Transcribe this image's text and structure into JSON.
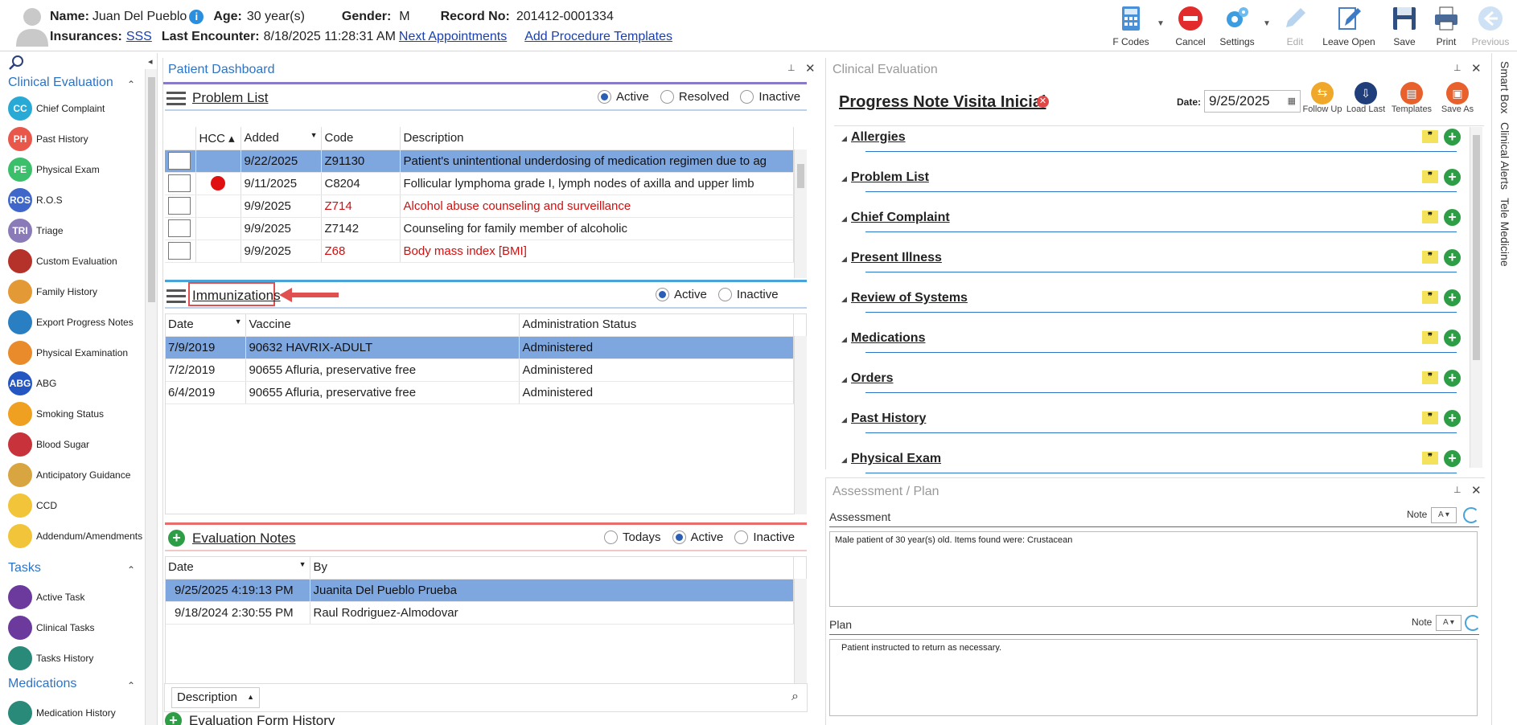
{
  "header": {
    "name_label": "Name:",
    "name": "Juan Del Pueblo",
    "age_label": "Age:",
    "age": "30 year(s)",
    "gender_label": "Gender:",
    "gender": "M",
    "record_label": "Record No:",
    "record": "201412-0001334",
    "insurances_label": "Insurances:",
    "insurance": "SSS",
    "last_encounter_label": "Last Encounter:",
    "last_encounter": "8/18/2025 11:28:31 AM",
    "next_appointments": "Next Appointments",
    "add_procedure_templates": "Add Procedure Templates"
  },
  "toolbar": {
    "fcodes": "F Codes",
    "cancel": "Cancel",
    "settings": "Settings",
    "edit": "Edit",
    "leave_open": "Leave Open",
    "save": "Save",
    "print": "Print",
    "previous": "Previous"
  },
  "sidebar": {
    "clinical_evaluation": "Clinical Evaluation",
    "items": [
      {
        "abbr": "CC",
        "label": "Chief Complaint",
        "color": "#29a9d6"
      },
      {
        "abbr": "PH",
        "label": "Past History",
        "color": "#e8574a"
      },
      {
        "abbr": "PE",
        "label": "Physical Exam",
        "color": "#3cbf6b"
      },
      {
        "abbr": "ROS",
        "label": "R.O.S",
        "color": "#3f66c9"
      },
      {
        "abbr": "TRI",
        "label": "Triage",
        "color": "#8a7bb8"
      },
      {
        "abbr": "",
        "label": "Custom Evaluation",
        "color": "#b5322a"
      },
      {
        "abbr": "",
        "label": "Family History",
        "color": "#e39a36"
      },
      {
        "abbr": "",
        "label": "Export Progress Notes",
        "color": "#2a7fc3"
      },
      {
        "abbr": "",
        "label": "Physical Examination",
        "color": "#e98b2b"
      },
      {
        "abbr": "ABG",
        "label": "ABG",
        "color": "#2456c2"
      },
      {
        "abbr": "",
        "label": "Smoking Status",
        "color": "#f0a020"
      },
      {
        "abbr": "",
        "label": "Blood Sugar",
        "color": "#c8323a"
      },
      {
        "abbr": "",
        "label": "Anticipatory Guidance",
        "color": "#d8a540"
      },
      {
        "abbr": "",
        "label": "CCD",
        "color": "#f2c43a"
      },
      {
        "abbr": "",
        "label": "Addendum/Amendments",
        "color": "#f2c43a"
      }
    ],
    "tasks": "Tasks",
    "task_items": [
      {
        "label": "Active Task",
        "color": "#6b3a9c"
      },
      {
        "label": "Clinical Tasks",
        "color": "#6b3a9c"
      },
      {
        "label": "Tasks History",
        "color": "#2a8a7a"
      }
    ],
    "medications": "Medications",
    "med_items": [
      {
        "label": "Medication History",
        "color": "#2a8a7a"
      }
    ]
  },
  "dashboard": {
    "title": "Patient Dashboard",
    "problem_list": {
      "title": "Problem List",
      "filters": [
        "Active",
        "Resolved",
        "Inactive"
      ],
      "columns": [
        "HCC",
        "Added",
        "Code",
        "Description"
      ],
      "rows": [
        {
          "hcc": "",
          "added": "9/22/2025",
          "code": "Z91130",
          "desc": "Patient's unintentional underdosing of medication regimen due to ag",
          "red": false,
          "selected": true
        },
        {
          "hcc": "dot",
          "added": "9/11/2025",
          "code": "C8204",
          "desc": "Follicular lymphoma grade I, lymph nodes of axilla and upper limb",
          "red": false,
          "selected": false
        },
        {
          "hcc": "",
          "added": "9/9/2025",
          "code": "Z714",
          "desc": "Alcohol abuse counseling and surveillance",
          "red": true,
          "selected": false
        },
        {
          "hcc": "",
          "added": "9/9/2025",
          "code": "Z7142",
          "desc": "Counseling for family member of alcoholic",
          "red": false,
          "selected": false
        },
        {
          "hcc": "",
          "added": "9/9/2025",
          "code": "Z68",
          "desc": "Body mass index [BMI]",
          "red": true,
          "selected": false
        }
      ]
    },
    "immunizations": {
      "title": "Immunizations",
      "filters": [
        "Active",
        "Inactive"
      ],
      "columns": [
        "Date",
        "Vaccine",
        "Administration Status"
      ],
      "rows": [
        {
          "date": "7/9/2019",
          "vaccine": "90632 HAVRIX-ADULT",
          "status": "Administered",
          "selected": true
        },
        {
          "date": "7/2/2019",
          "vaccine": "90655 Afluria, preservative free",
          "status": "Administered",
          "selected": false
        },
        {
          "date": "6/4/2019",
          "vaccine": "90655 Afluria, preservative free",
          "status": "Administered",
          "selected": false
        }
      ]
    },
    "evaluation_notes": {
      "title": "Evaluation Notes",
      "filters": [
        "Todays",
        "Active",
        "Inactive"
      ],
      "columns": [
        "Date",
        "By"
      ],
      "rows": [
        {
          "date": "9/25/2025 4:19:13 PM",
          "by": "Juanita Del Pueblo Prueba",
          "selected": true
        },
        {
          "date": "9/18/2024 2:30:55 PM",
          "by": "Raul Rodriguez-Almodovar",
          "selected": false
        }
      ]
    },
    "evaluation_form_history": {
      "title": "Evaluation Form History",
      "column": "Description"
    }
  },
  "clinical_eval": {
    "title": "Clinical Evaluation",
    "note_title": "Progress Note Visita Inicial",
    "date_label": "Date:",
    "date": "9/25/2025",
    "actions": [
      "Follow Up",
      "Load Last",
      "Templates",
      "Save As"
    ],
    "sections": [
      "Allergies",
      "Problem List",
      "Chief Complaint",
      "Present Illness",
      "Review of Systems",
      "Medications",
      "Orders",
      "Past History",
      "Physical Exam"
    ]
  },
  "assessment_plan": {
    "title": "Assessment / Plan",
    "assessment_label": "Assessment",
    "note_label": "Note",
    "assessment_text": "Male patient of 30 year(s) old. Items found were:  Crustacean",
    "plan_label": "Plan",
    "plan_text": "Patient instructed to return as necessary."
  },
  "right_tabs": [
    "Smart Box",
    "Clinical Alerts",
    "Tele Medicine"
  ],
  "colors": {
    "accent": "#2b74c7",
    "selection": "#7ea6df",
    "alert_red": "#d01010"
  }
}
